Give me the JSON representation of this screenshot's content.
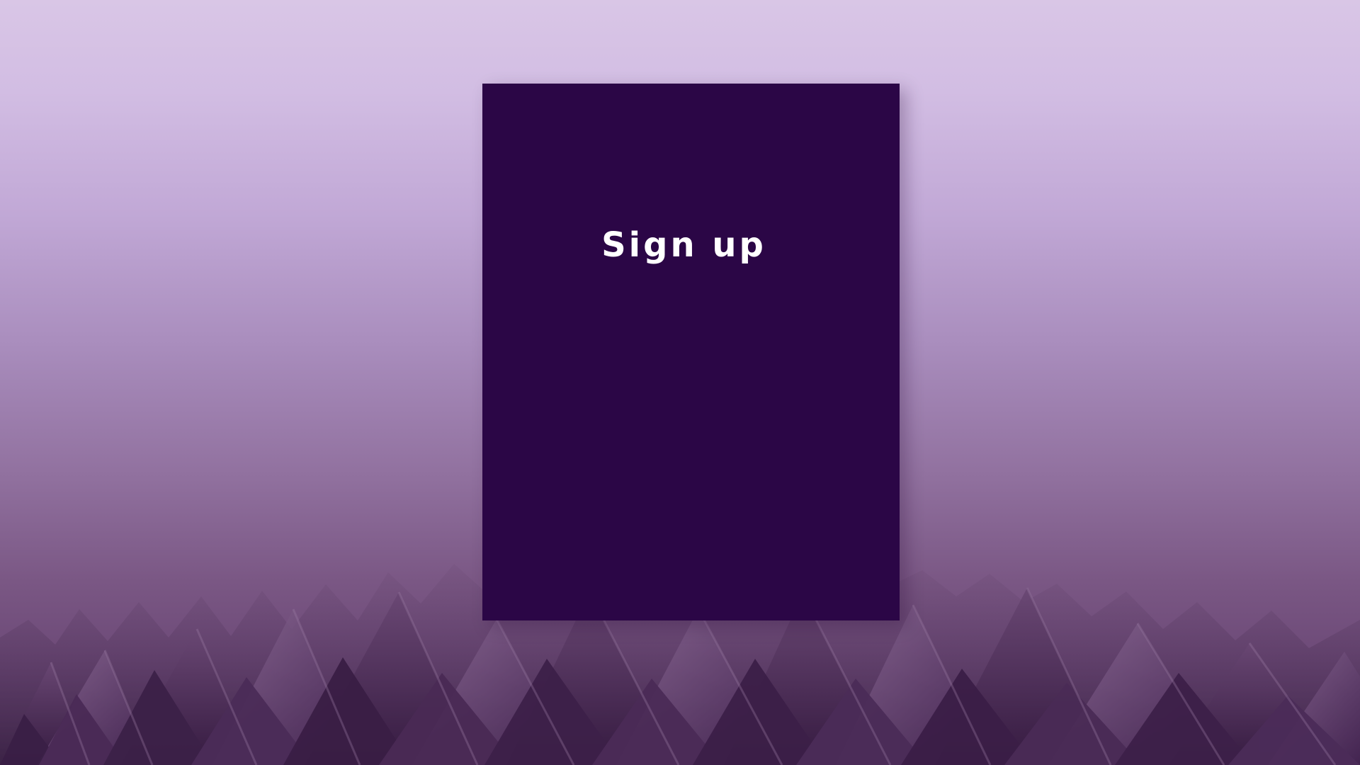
{
  "page": {
    "title": "Sign up"
  },
  "colors": {
    "background_top": "#d9c6e6",
    "background_bottom": "#5a3a63",
    "card": "#2b0646",
    "title": "#ffffff",
    "spike_light": "#7a5a84",
    "spike_dark": "#3c2148"
  },
  "icons": [
    "purple-spike-landscape-background"
  ]
}
